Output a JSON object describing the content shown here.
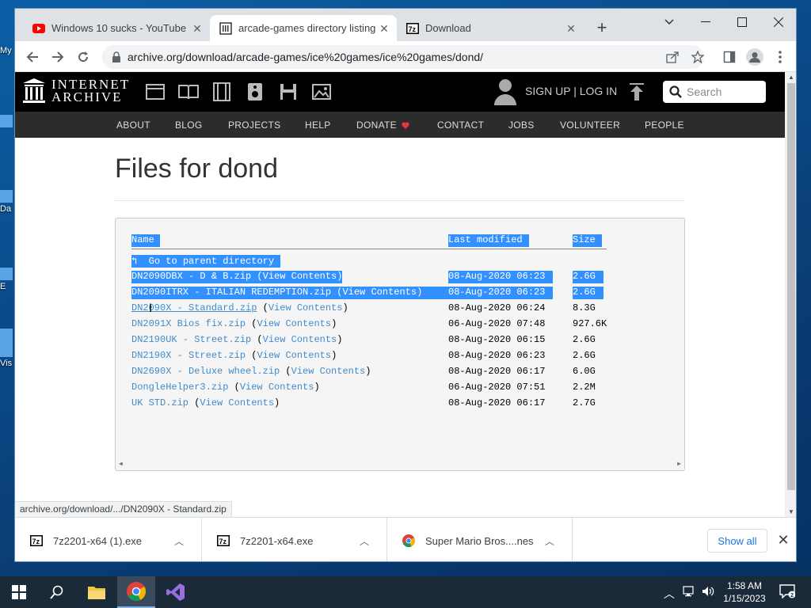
{
  "desktop": {
    "icons": [
      {
        "label": "My"
      },
      {
        "label": "Da"
      },
      {
        "label": "E"
      },
      {
        "label": "Vis"
      }
    ]
  },
  "browser": {
    "tabs": [
      {
        "title": "Windows 10 sucks - YouTube",
        "icon": "youtube-icon"
      },
      {
        "title": "arcade-games directory listing",
        "icon": "archive-icon"
      },
      {
        "title": "Download",
        "icon": "7zip-icon"
      }
    ],
    "url": "archive.org/download/arcade-games/ice%20games/ice%20games/dond/",
    "status_url": "archive.org/download/.../DN2090X - Standard.zip"
  },
  "ia": {
    "logo_line1": "INTERNET",
    "logo_line2": "ARCHIVE",
    "signin": "SIGN UP | LOG IN",
    "search_placeholder": "Search",
    "nav": [
      "ABOUT",
      "BLOG",
      "PROJECTS",
      "HELP",
      "DONATE",
      "CONTACT",
      "JOBS",
      "VOLUNTEER",
      "PEOPLE"
    ]
  },
  "page": {
    "title": "Files for dond",
    "headers": {
      "name": "Name",
      "modified": "Last modified",
      "size": "Size"
    },
    "parent": "Go to parent directory",
    "view_contents": "View Contents",
    "files": [
      {
        "name": "DN2090DBX - D & B.zip",
        "date": "08-Aug-2020 06:23",
        "size": "2.6G",
        "contents": true
      },
      {
        "name": "DN2090ITRX - ITALIAN REDEMPTION.zip",
        "date": "08-Aug-2020 06:23",
        "size": "2.6G",
        "contents": true
      },
      {
        "name": "DN2090X - Standard.zip",
        "date": "08-Aug-2020 06:24",
        "size": "8.3G",
        "contents": true
      },
      {
        "name": "DN2091X Bios fix.zip",
        "date": "06-Aug-2020 07:48",
        "size": "927.6K",
        "contents": true
      },
      {
        "name": "DN2190UK - Street.zip",
        "date": "08-Aug-2020 06:15",
        "size": "2.6G",
        "contents": true
      },
      {
        "name": "DN2190X - Street.zip",
        "date": "08-Aug-2020 06:23",
        "size": "2.6G",
        "contents": true
      },
      {
        "name": "DN2690X - Deluxe wheel.zip",
        "date": "08-Aug-2020 06:17",
        "size": "6.0G",
        "contents": true
      },
      {
        "name": "DongleHelper3.zip",
        "date": "06-Aug-2020 07:51",
        "size": "2.2M",
        "contents": true
      },
      {
        "name": "UK STD.zip",
        "date": "08-Aug-2020 06:17",
        "size": "2.7G",
        "contents": true
      }
    ]
  },
  "downloads": [
    {
      "name": "7z2201-x64 (1).exe",
      "icon": "7zip-icon"
    },
    {
      "name": "7z2201-x64.exe",
      "icon": "7zip-icon"
    },
    {
      "name": "Super Mario Bros....nes",
      "icon": "chrome-icon"
    }
  ],
  "downloads_show_all": "Show all",
  "taskbar": {
    "time": "1:58 AM",
    "date": "1/15/2023"
  },
  "colors": {
    "selection": "#3390ff",
    "link": "#428bca",
    "ia_black": "#000000",
    "ia_nav": "#2c2c2c"
  }
}
